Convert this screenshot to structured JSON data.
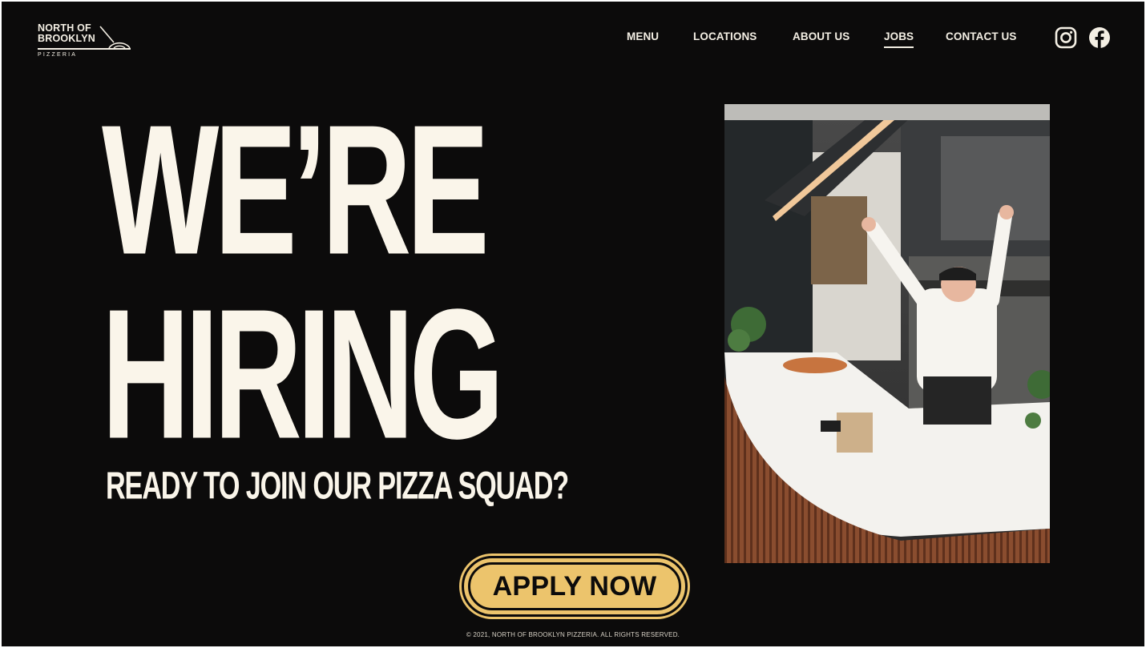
{
  "brand": {
    "name_line1": "NORTH OF",
    "name_line2": "BROOKLYN",
    "subtitle": "PIZZERIA",
    "text_color": "#f4efe4"
  },
  "nav": {
    "items": [
      {
        "label": "MENU",
        "active": false
      },
      {
        "label": "LOCATIONS",
        "active": false
      },
      {
        "label": "ABOUT US",
        "active": false
      },
      {
        "label": "JOBS",
        "active": true
      },
      {
        "label": "CONTACT US",
        "active": false
      }
    ]
  },
  "social": {
    "icons": [
      "instagram-icon",
      "facebook-icon"
    ]
  },
  "hero": {
    "title_line1": "WE’RE",
    "title_line2": "HIRING",
    "subheading": "READY TO JOIN OUR PIZZA SQUAD?",
    "text_color": "#faf5ea",
    "background_color": "#0c0b0b"
  },
  "cta": {
    "label": "APPLY NOW",
    "color": "#ecc46c"
  },
  "footer": {
    "copyright": "© 2021, NORTH OF BROOKLYN PIZZERIA. ALL RIGHTS RESERVED."
  }
}
